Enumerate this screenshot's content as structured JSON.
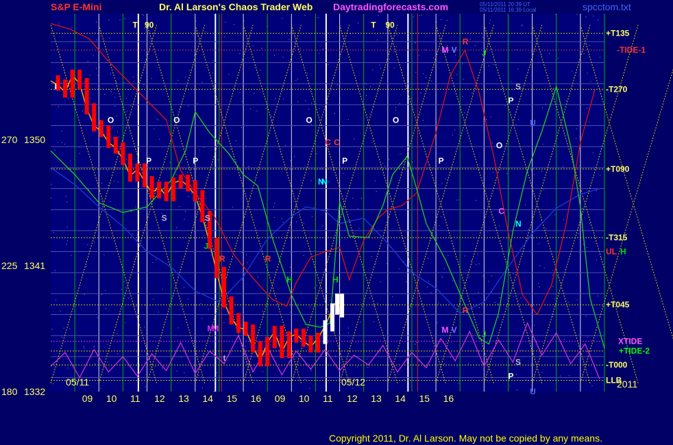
{
  "header": {
    "symbol": "S&P E-Mini",
    "title": "Dr. Al Larson's Chaos Trader Web",
    "site": "Daytradingforecasts.com",
    "stamp_1": "05/11/2011 20:39 UT",
    "stamp_2": "05/11/2011 16:39 Local",
    "file": "spcctom.txt"
  },
  "footer": {
    "copyright": "Copyright 2011, Dr. Al Larson. May not be copied by any means."
  },
  "colors": {
    "background": "#000066",
    "plot_bg": "#00007a",
    "grid_yellow": "#e0e000",
    "grid_green": "#00c000",
    "price_up": "#ff0000",
    "price_recent": "#ffffff",
    "green_flux": "#22cc22",
    "red_flux": "#dd1111",
    "blue_flux": "#1a3ad8",
    "magenta_flux": "#cc33cc"
  },
  "chart_data": {
    "type": "line",
    "title": "S&P E-Mini",
    "x_ticks": [
      "09",
      "10",
      "11",
      "12",
      "13",
      "14",
      "15",
      "16",
      "09",
      "10",
      "11",
      "12",
      "13",
      "14",
      "15",
      "16"
    ],
    "date_labels": [
      "05/11",
      "05/12"
    ],
    "year_label": "2011",
    "y_ticks": [
      {
        "angle": "270",
        "price": "1350"
      },
      {
        "angle": "225",
        "price": "1341"
      },
      {
        "angle": "180",
        "price": "1332"
      }
    ],
    "ylim": [
      1332,
      1359
    ],
    "level_labels": [
      {
        "text": "+T135",
        "price": 1357.6,
        "color": "#ffff66"
      },
      {
        "text": "-TIDE-1",
        "price": 1356.4,
        "color": "#ff3333"
      },
      {
        "text": "-T270",
        "price": 1353.6,
        "color": "#ffff66"
      },
      {
        "text": "+T090",
        "price": 1347.9,
        "color": "#ffff66"
      },
      {
        "text": "-T315",
        "price": 1343.0,
        "color": "#ffff66"
      },
      {
        "text": "UL",
        "price": 1342.0,
        "color": "#ff3333"
      },
      {
        "text": "H",
        "price": 1342.0,
        "color": "#00dd00"
      },
      {
        "text": "+T045",
        "price": 1338.2,
        "color": "#ffff66"
      },
      {
        "text": "XTIDE",
        "price": 1335.6,
        "color": "#ff55ff"
      },
      {
        "text": "+TIDE-2",
        "price": 1334.9,
        "color": "#00ff00"
      },
      {
        "text": "-T000",
        "price": 1333.9,
        "color": "#ffff66"
      },
      {
        "text": "LLB",
        "price": 1332.8,
        "color": "#ffff66"
      }
    ],
    "markers": [
      {
        "t": "T",
        "x": 9.7,
        "y": 1358.0,
        "c": "#ffff66"
      },
      {
        "t": "90",
        "x": 9.95,
        "y": 1358.0,
        "c": "#ffff66"
      },
      {
        "t": "T",
        "x": 14.65,
        "y": 1358.0,
        "c": "#ffff66"
      },
      {
        "t": "90",
        "x": 14.95,
        "y": 1358.0,
        "c": "#ffff66"
      },
      {
        "t": "O",
        "x": 9.18,
        "y": 1351.2,
        "c": "#ffffff"
      },
      {
        "t": "O",
        "x": 13.3,
        "y": 1351.2,
        "c": "#ffffff"
      },
      {
        "t": "O",
        "x": 10.55,
        "y": 1351.2,
        "c": "#ffffff"
      },
      {
        "t": "O",
        "x": 15.1,
        "y": 1351.2,
        "c": "#ffffff"
      },
      {
        "t": "P",
        "x": 9.98,
        "y": 1348.3,
        "c": "#ffffff"
      },
      {
        "t": "P",
        "x": 14.05,
        "y": 1348.3,
        "c": "#ffffff"
      },
      {
        "t": "P",
        "x": 10.95,
        "y": 1348.3,
        "c": "#ffffff"
      },
      {
        "t": "P",
        "x": 16.05,
        "y": 1348.3,
        "c": "#ffffff"
      },
      {
        "t": "C",
        "x": 13.88,
        "y": 1349.6,
        "c": "#ff3333"
      },
      {
        "t": "C",
        "x": 13.7,
        "y": 1349.6,
        "c": "#ff3333"
      },
      {
        "t": "N",
        "x": 13.62,
        "y": 1346.8,
        "c": "#00ffff"
      },
      {
        "t": "N",
        "x": 13.55,
        "y": 1346.8,
        "c": "#00ffff"
      },
      {
        "t": "S",
        "x": 10.3,
        "y": 1344.2,
        "c": "#bbbbbb"
      },
      {
        "t": "S",
        "x": 11.2,
        "y": 1344.2,
        "c": "#bbbbbb"
      },
      {
        "t": "J",
        "x": 11.18,
        "y": 1342.2,
        "c": "#00cc00"
      },
      {
        "t": "R",
        "x": 11.5,
        "y": 1341.3,
        "c": "#ff3333"
      },
      {
        "t": "R",
        "x": 12.45,
        "y": 1341.3,
        "c": "#ff3333"
      },
      {
        "t": "H",
        "x": 12.9,
        "y": 1339.8,
        "c": "#00dd00"
      },
      {
        "t": "H",
        "x": 13.85,
        "y": 1339.8,
        "c": "#00dd00"
      },
      {
        "t": "M",
        "x": 11.25,
        "y": 1336.3,
        "c": "#dd33dd"
      },
      {
        "t": "M",
        "x": 11.35,
        "y": 1336.3,
        "c": "#dd33dd"
      },
      {
        "t": "t",
        "x": 11.58,
        "y": 1334.2,
        "c": "#bbbbbb"
      },
      {
        "t": "I",
        "x": 8.08,
        "y": 1353.6,
        "c": "#ffffff"
      },
      {
        "t": "M",
        "x": 16.12,
        "y": 1356.2,
        "c": "#ff55ff"
      },
      {
        "t": "V",
        "x": 16.32,
        "y": 1356.2,
        "c": "#7777ff"
      },
      {
        "t": "R",
        "x": 16.55,
        "y": 1356.8,
        "c": "#ff3333"
      },
      {
        "t": "J",
        "x": 16.95,
        "y": 1356.0,
        "c": "#00cc00"
      },
      {
        "t": "S",
        "x": 17.65,
        "y": 1353.6,
        "c": "#bbbbbb"
      },
      {
        "t": "P",
        "x": 17.5,
        "y": 1352.6,
        "c": "#ffffff"
      },
      {
        "t": "U",
        "x": 17.95,
        "y": 1351.0,
        "c": "#4466ff"
      },
      {
        "t": "O",
        "x": 17.25,
        "y": 1349.4,
        "c": "#ffffff"
      },
      {
        "t": "C",
        "x": 17.3,
        "y": 1344.7,
        "c": "#ff55ff"
      },
      {
        "t": "N",
        "x": 17.65,
        "y": 1343.8,
        "c": "#00ffff"
      },
      {
        "t": "R",
        "x": 16.55,
        "y": 1337.6,
        "c": "#ff3333"
      },
      {
        "t": "M",
        "x": 16.12,
        "y": 1336.2,
        "c": "#ff55ff"
      },
      {
        "t": "V",
        "x": 16.32,
        "y": 1336.2,
        "c": "#7777ff"
      },
      {
        "t": "J",
        "x": 16.95,
        "y": 1335.9,
        "c": "#00cc00"
      },
      {
        "t": "S",
        "x": 17.65,
        "y": 1333.9,
        "c": "#bbbbbb"
      },
      {
        "t": "P",
        "x": 17.5,
        "y": 1332.9,
        "c": "#ffffff"
      },
      {
        "t": "U",
        "x": 17.95,
        "y": 1331.8,
        "c": "#4466ff"
      }
    ],
    "price_series": [
      [
        8.0,
        1354.2
      ],
      [
        8.15,
        1353.9
      ],
      [
        8.3,
        1353.4
      ],
      [
        8.45,
        1354.6
      ],
      [
        8.6,
        1354.0
      ],
      [
        8.75,
        1352.2
      ],
      [
        8.9,
        1351.0
      ],
      [
        9.05,
        1350.6
      ],
      [
        9.2,
        1349.8
      ],
      [
        9.35,
        1349.4
      ],
      [
        9.5,
        1348.6
      ],
      [
        9.65,
        1347.4
      ],
      [
        9.8,
        1347.9
      ],
      [
        9.95,
        1347.0
      ],
      [
        10.1,
        1346.2
      ],
      [
        10.25,
        1346.6
      ],
      [
        10.4,
        1346.0
      ],
      [
        10.55,
        1346.9
      ],
      [
        10.7,
        1347.1
      ],
      [
        10.85,
        1346.7
      ],
      [
        11.0,
        1346.0
      ],
      [
        11.15,
        1344.5
      ],
      [
        11.3,
        1342.6
      ],
      [
        11.45,
        1340.5
      ],
      [
        11.6,
        1338.4
      ],
      [
        11.75,
        1337.2
      ],
      [
        11.9,
        1336.6
      ],
      [
        12.05,
        1336.4
      ],
      [
        12.2,
        1335.2
      ],
      [
        12.35,
        1334.2
      ],
      [
        12.5,
        1335.5
      ],
      [
        12.65,
        1336.3
      ],
      [
        12.8,
        1334.8
      ],
      [
        12.95,
        1335.9
      ],
      [
        13.1,
        1336.1
      ],
      [
        13.25,
        1335.6
      ],
      [
        13.4,
        1335.2
      ],
      [
        13.55,
        1335.8
      ],
      [
        13.7,
        1336.7
      ],
      [
        13.85,
        1337.9
      ],
      [
        13.95,
        1338.6
      ],
      [
        14.05,
        1337.7
      ]
    ],
    "green_flux": [
      [
        8.0,
        1349.2
      ],
      [
        8.5,
        1347.5
      ],
      [
        9.0,
        1345.5
      ],
      [
        9.5,
        1344.8
      ],
      [
        10.0,
        1345.2
      ],
      [
        10.5,
        1347.1
      ],
      [
        10.8,
        1349.2
      ],
      [
        11.0,
        1352.0
      ],
      [
        11.3,
        1350.5
      ],
      [
        11.7,
        1349.0
      ],
      [
        12.0,
        1347.5
      ],
      [
        12.3,
        1346.7
      ],
      [
        12.6,
        1343.0
      ],
      [
        13.0,
        1338.9
      ],
      [
        13.3,
        1336.8
      ],
      [
        13.6,
        1336.6
      ],
      [
        13.8,
        1336.9
      ],
      [
        14.0,
        1345.6
      ],
      [
        14.2,
        1343.1
      ],
      [
        14.6,
        1343.0
      ],
      [
        14.9,
        1345.3
      ],
      [
        15.1,
        1347.5
      ],
      [
        15.4,
        1348.8
      ],
      [
        15.6,
        1346.5
      ],
      [
        15.8,
        1344.0
      ],
      [
        16.2,
        1341.4
      ],
      [
        16.6,
        1338.2
      ],
      [
        16.9,
        1335.8
      ],
      [
        17.1,
        1335.4
      ],
      [
        17.3,
        1337.6
      ],
      [
        17.6,
        1343.5
      ],
      [
        17.9,
        1347.8
      ],
      [
        18.2,
        1350.6
      ],
      [
        18.5,
        1353.8
      ],
      [
        18.8,
        1349.5
      ],
      [
        19.0,
        1345.2
      ],
      [
        19.2,
        1338.7
      ],
      [
        19.5,
        1335.1
      ]
    ],
    "red_flux": [
      [
        8.0,
        1358.3
      ],
      [
        8.4,
        1357.9
      ],
      [
        8.8,
        1357.2
      ],
      [
        9.2,
        1355.6
      ],
      [
        9.6,
        1354.2
      ],
      [
        10.0,
        1352.8
      ],
      [
        10.4,
        1351.4
      ],
      [
        10.7,
        1347.8
      ],
      [
        11.0,
        1346.2
      ],
      [
        11.4,
        1344.5
      ],
      [
        11.8,
        1341.8
      ],
      [
        12.2,
        1340.1
      ],
      [
        12.6,
        1338.6
      ],
      [
        12.9,
        1338.1
      ],
      [
        13.1,
        1339.8
      ],
      [
        13.4,
        1341.6
      ],
      [
        13.7,
        1342.0
      ],
      [
        14.0,
        1342.3
      ],
      [
        14.2,
        1340.0
      ],
      [
        14.5,
        1342.8
      ],
      [
        14.8,
        1344.4
      ],
      [
        15.0,
        1345.0
      ],
      [
        15.3,
        1345.3
      ],
      [
        15.6,
        1346.2
      ],
      [
        16.0,
        1350.5
      ],
      [
        16.3,
        1354.6
      ],
      [
        16.6,
        1356.4
      ],
      [
        16.9,
        1353.3
      ],
      [
        17.2,
        1348.8
      ],
      [
        17.5,
        1343.4
      ],
      [
        17.8,
        1338.9
      ],
      [
        18.1,
        1337.5
      ],
      [
        18.4,
        1339.6
      ],
      [
        18.7,
        1343.9
      ],
      [
        19.0,
        1349.8
      ],
      [
        19.3,
        1353.6
      ]
    ],
    "blue_flux": [
      [
        8.0,
        1348.0
      ],
      [
        8.5,
        1346.8
      ],
      [
        9.0,
        1345.2
      ],
      [
        9.5,
        1343.8
      ],
      [
        10.0,
        1342.0
      ],
      [
        10.5,
        1340.9
      ],
      [
        11.0,
        1339.2
      ],
      [
        11.5,
        1338.4
      ],
      [
        12.0,
        1340.2
      ],
      [
        12.5,
        1342.9
      ],
      [
        13.0,
        1344.5
      ],
      [
        13.3,
        1345.2
      ],
      [
        13.7,
        1344.9
      ],
      [
        14.0,
        1344.0
      ],
      [
        14.5,
        1344.4
      ],
      [
        15.0,
        1342.6
      ],
      [
        15.5,
        1340.5
      ],
      [
        16.0,
        1339.4
      ],
      [
        16.5,
        1337.6
      ],
      [
        17.0,
        1338.4
      ],
      [
        17.5,
        1340.9
      ],
      [
        18.0,
        1343.3
      ],
      [
        18.5,
        1345.1
      ],
      [
        19.0,
        1346.1
      ],
      [
        19.4,
        1346.5
      ]
    ],
    "magenta_flux": [
      [
        8.0,
        1333.8
      ],
      [
        8.3,
        1334.8
      ],
      [
        8.6,
        1333.0
      ],
      [
        8.9,
        1335.0
      ],
      [
        9.2,
        1333.4
      ],
      [
        9.5,
        1334.5
      ],
      [
        9.8,
        1333.1
      ],
      [
        10.1,
        1334.7
      ],
      [
        10.4,
        1333.5
      ],
      [
        10.7,
        1335.5
      ],
      [
        11.0,
        1333.3
      ],
      [
        11.3,
        1334.9
      ],
      [
        11.6,
        1334.0
      ],
      [
        11.9,
        1336.0
      ],
      [
        12.2,
        1333.4
      ],
      [
        12.5,
        1335.2
      ],
      [
        12.8,
        1333.2
      ],
      [
        13.1,
        1334.9
      ],
      [
        13.4,
        1333.6
      ],
      [
        13.7,
        1335.0
      ],
      [
        14.0,
        1333.5
      ],
      [
        14.3,
        1334.6
      ],
      [
        14.6,
        1333.9
      ],
      [
        14.9,
        1335.3
      ],
      [
        15.2,
        1333.4
      ],
      [
        15.5,
        1334.8
      ],
      [
        15.8,
        1333.7
      ],
      [
        16.1,
        1335.8
      ],
      [
        16.4,
        1334.2
      ],
      [
        16.7,
        1336.3
      ],
      [
        17.0,
        1333.8
      ],
      [
        17.3,
        1335.7
      ],
      [
        17.6,
        1334.1
      ],
      [
        17.9,
        1336.9
      ],
      [
        18.2,
        1334.6
      ],
      [
        18.5,
        1336.2
      ],
      [
        18.8,
        1334.0
      ],
      [
        19.1,
        1335.4
      ],
      [
        19.4,
        1332.9
      ]
    ],
    "grid": true
  }
}
